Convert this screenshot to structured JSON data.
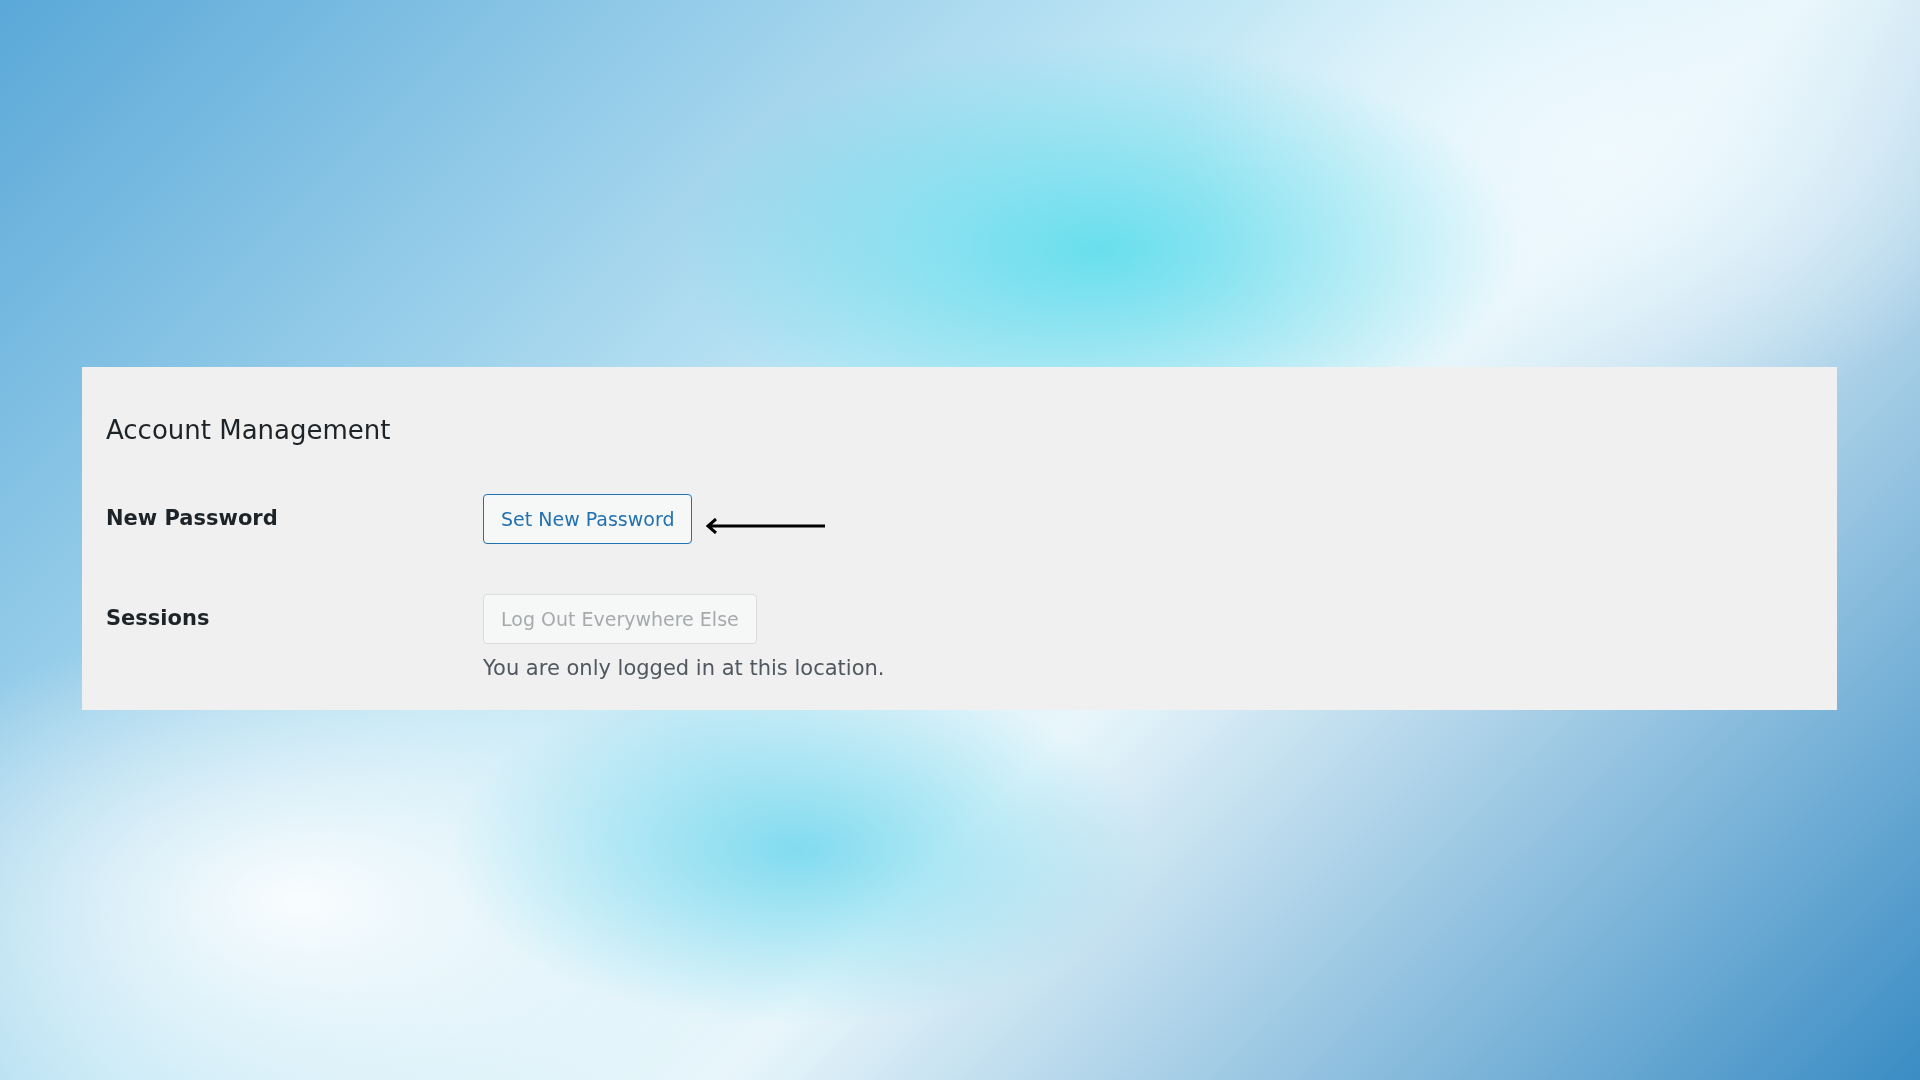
{
  "panel": {
    "title": "Account Management",
    "rows": [
      {
        "label": "New Password",
        "button": {
          "label": "Set New Password",
          "disabled": false
        },
        "pointer_arrow": true
      },
      {
        "label": "Sessions",
        "button": {
          "label": "Log Out Everywhere Else",
          "disabled": true
        },
        "pointer_arrow": false,
        "description": "You are only logged in at this location."
      }
    ]
  }
}
